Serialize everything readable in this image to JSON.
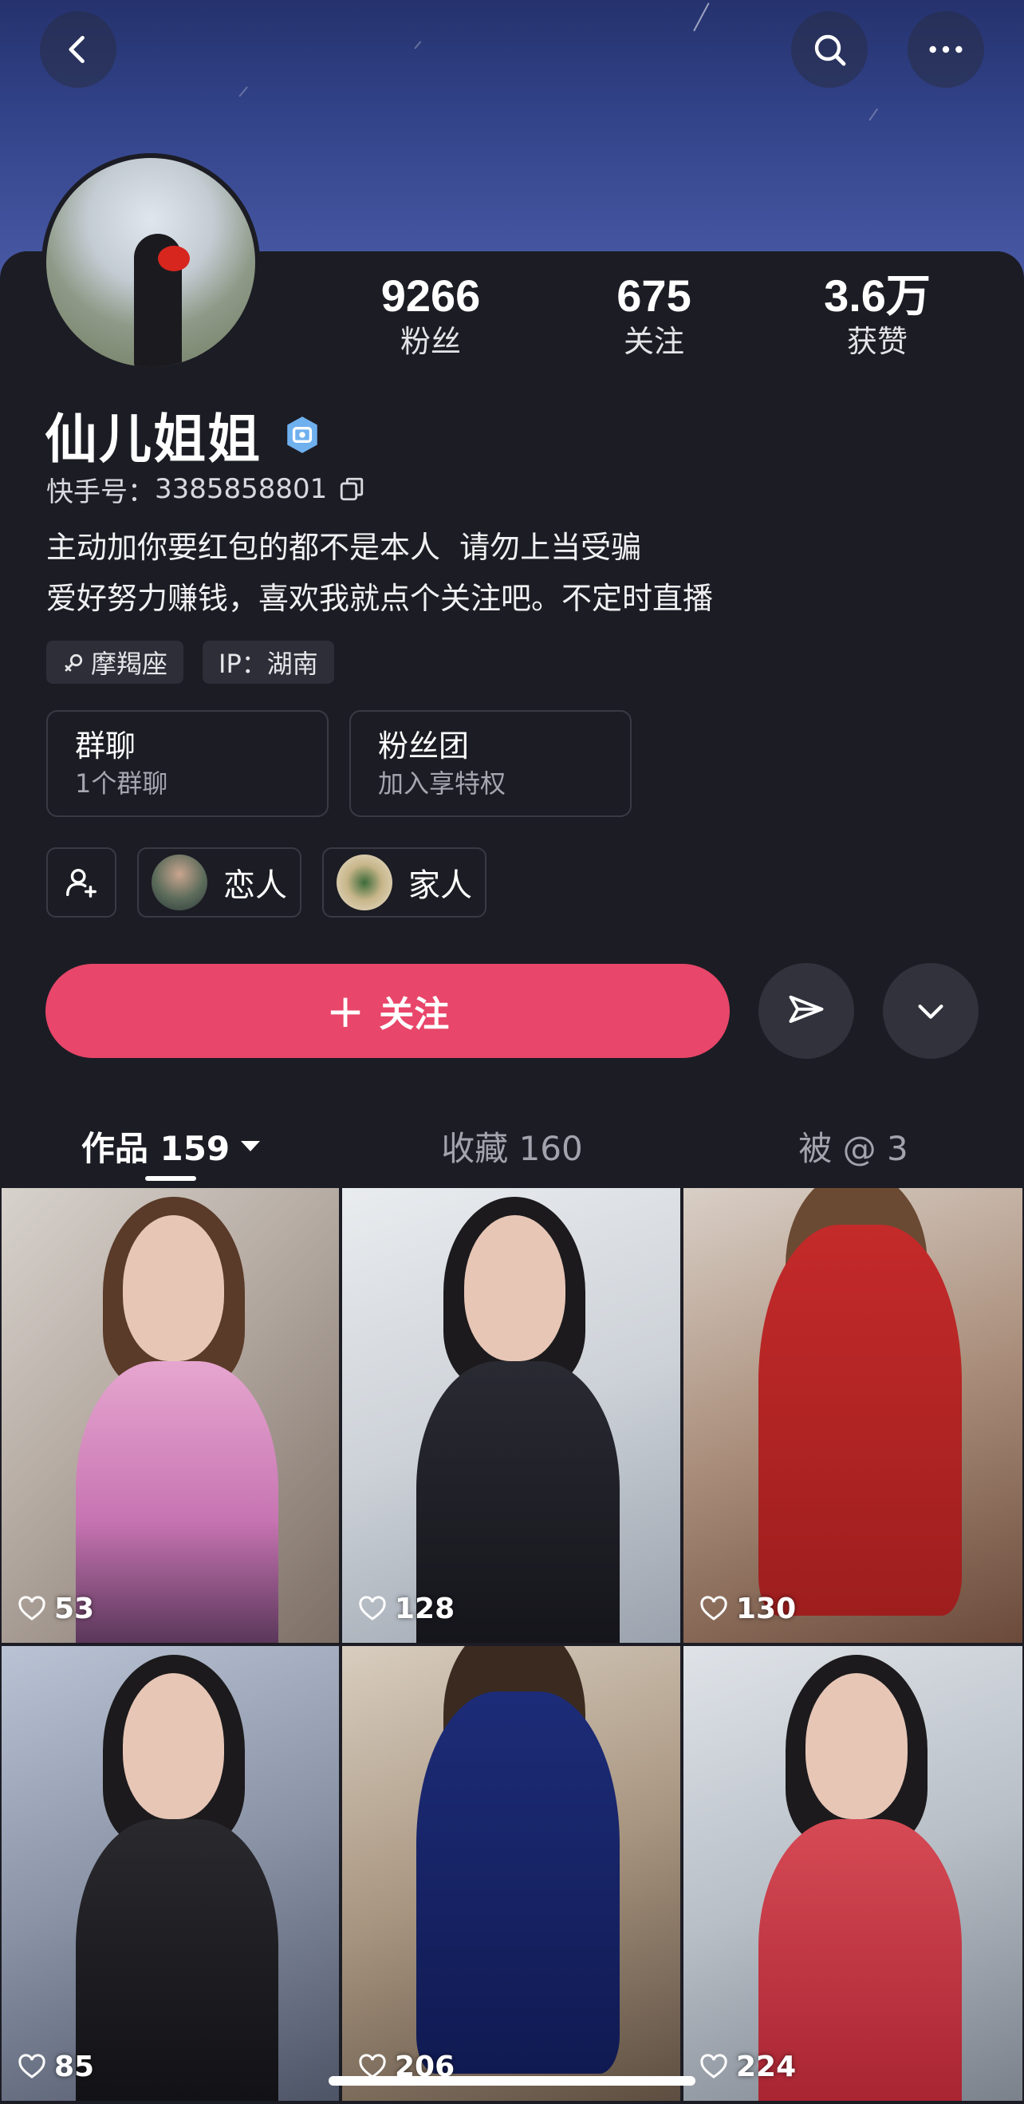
{
  "header": {
    "back_icon": "chevron-left-icon",
    "search_icon": "search-icon",
    "more_icon": "more-horizontal-icon"
  },
  "profile": {
    "name": "仙儿姐姐",
    "kuaishou_id_label": "快手号：",
    "kuaishou_id": "3385858801",
    "bio_line1": "主动加你要红包的都不是本人  请勿上当受骗",
    "bio_line2": "爱好努力赚钱，喜欢我就点个关注吧。不定时直播",
    "tags": [
      "摩羯座",
      "IP：湖南"
    ]
  },
  "stats": [
    {
      "value": "9266",
      "label": "粉丝"
    },
    {
      "value": "675",
      "label": "关注"
    },
    {
      "value": "3.6万",
      "label": "获赞"
    }
  ],
  "cards": [
    {
      "title": "群聊",
      "subtitle": "1个群聊"
    },
    {
      "title": "粉丝团",
      "subtitle": "加入享特权"
    }
  ],
  "relations": [
    {
      "label": "恋人"
    },
    {
      "label": "家人"
    }
  ],
  "actions": {
    "follow_label": "关注"
  },
  "tabs": [
    {
      "label": "作品 159",
      "active": true
    },
    {
      "label": "收藏 160",
      "active": false
    },
    {
      "label": "被 @ 3",
      "active": false
    }
  ],
  "videos": [
    {
      "likes": "53"
    },
    {
      "likes": "128"
    },
    {
      "likes": "130"
    },
    {
      "likes": "85"
    },
    {
      "likes": "206"
    },
    {
      "likes": "224"
    }
  ],
  "colors": {
    "accent": "#e8466a",
    "background": "#1c1c24"
  }
}
